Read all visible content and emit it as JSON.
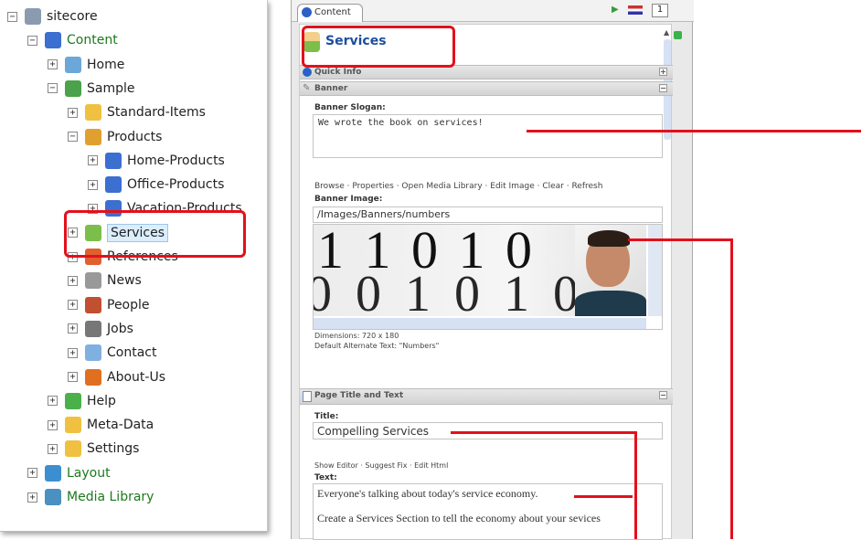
{
  "tree": {
    "items": [
      {
        "label": "sitecore",
        "expander": "⊟",
        "icon": "page-icon",
        "color": "#8a9bb0",
        "green": false
      },
      {
        "label": "Content",
        "expander": "⊟",
        "icon": "cubes-icon",
        "color": "#3b6fd0",
        "green": true
      },
      {
        "label": "Home",
        "expander": "⊞",
        "icon": "home-icon",
        "color": "#6ba7d8",
        "green": false
      },
      {
        "label": "Sample",
        "expander": "⊟",
        "icon": "house-icon",
        "color": "#4aa24a",
        "green": false
      },
      {
        "label": "Standard-Items",
        "expander": "⊞",
        "icon": "folder-icon",
        "color": "#f0c040",
        "green": false
      },
      {
        "label": "Products",
        "expander": "⊟",
        "icon": "package-icon",
        "color": "#e0a030",
        "green": false
      },
      {
        "label": "Home-Products",
        "expander": "⊞",
        "icon": "cubes-icon",
        "color": "#3b6fd0",
        "green": false
      },
      {
        "label": "Office-Products",
        "expander": "⊞",
        "icon": "cubes-icon",
        "color": "#3b6fd0",
        "green": false
      },
      {
        "label": "Vacation-Products",
        "expander": "⊞",
        "icon": "cubes-icon",
        "color": "#3b6fd0",
        "green": false
      },
      {
        "label": "Services",
        "expander": "⊞",
        "icon": "person-icon",
        "color": "#7bbf4a",
        "green": false
      },
      {
        "label": "References",
        "expander": "⊞",
        "icon": "references-icon",
        "color": "#e06030",
        "green": false
      },
      {
        "label": "News",
        "expander": "⊞",
        "icon": "news-icon",
        "color": "#999999",
        "green": false
      },
      {
        "label": "People",
        "expander": "⊞",
        "icon": "people-icon",
        "color": "#c05030",
        "green": false
      },
      {
        "label": "Jobs",
        "expander": "⊞",
        "icon": "jobs-icon",
        "color": "#777777",
        "green": false
      },
      {
        "label": "Contact",
        "expander": "⊞",
        "icon": "contact-icon",
        "color": "#7fb0e0",
        "green": false
      },
      {
        "label": "About-Us",
        "expander": "⊞",
        "icon": "group-icon",
        "color": "#e07020",
        "green": false
      },
      {
        "label": "Help",
        "expander": "⊞",
        "icon": "help-icon",
        "color": "#4ab04a",
        "green": false
      },
      {
        "label": "Meta-Data",
        "expander": "⊞",
        "icon": "folder-icon",
        "color": "#f0c040",
        "green": false
      },
      {
        "label": "Settings",
        "expander": "⊞",
        "icon": "folder-icon",
        "color": "#f0c040",
        "green": false
      },
      {
        "label": "Layout",
        "expander": "⊞",
        "icon": "layout-icon",
        "color": "#3b8fd0",
        "green": true
      },
      {
        "label": "Media Library",
        "expander": "⊞",
        "icon": "media-icon",
        "color": "#4a90c0",
        "green": true
      }
    ]
  },
  "editor": {
    "tab_label": "Content",
    "item_title": "Services",
    "sections": {
      "quick_info": "Quick Info",
      "banner": "Banner",
      "page_title_text": "Page Title and Text"
    },
    "banner_slogan_label": "Banner Slogan:",
    "banner_slogan_value": "We wrote the book on services!",
    "image_links": "Browse · Properties · Open Media Library · Edit Image · Clear · Refresh",
    "banner_image_label": "Banner Image:",
    "banner_image_path": "/Images/Banners/numbers",
    "image_digits": "1 1 0 1 0",
    "image_digits2": "0 0 1 0 1 0",
    "image_dimensions": "Dimensions: 720 x 180",
    "image_alt": "Default Alternate Text: \"Numbers\"",
    "title_label": "Title:",
    "title_value": "Compelling Services",
    "text_links": "Show Editor · Suggest Fix · Edit Html",
    "text_label": "Text:",
    "text_line1": "Everyone's talking about today's service economy.",
    "text_line2": "Create a Services Section to tell the economy about your sevices",
    "toolbar_lang": "1"
  },
  "colors": {
    "annotation": "#e3101c",
    "selection": "#dbeefc",
    "tree_green": "#1c7a1c"
  }
}
